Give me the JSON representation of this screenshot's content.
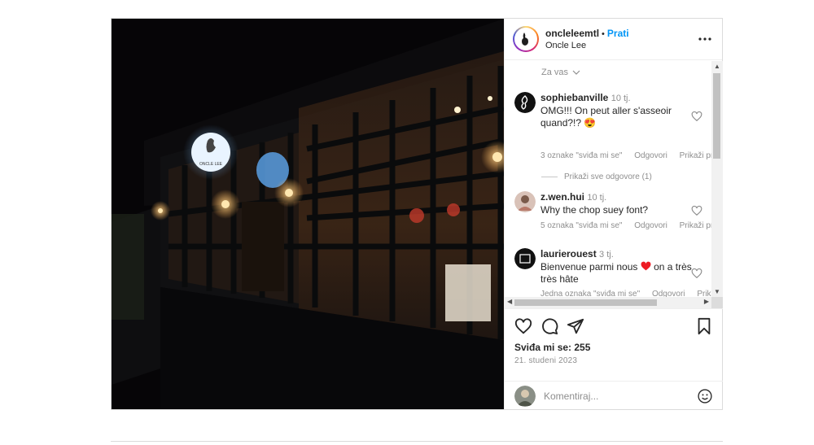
{
  "post": {
    "username": "oncleleemtl",
    "separator": "•",
    "follow_label": "Prati",
    "location": "Oncle Lee",
    "sort_label": "Za vas",
    "likes_text": "Sviđa mi se: 255",
    "date_text": "21. studeni 2023",
    "comment_placeholder": "Komentiraj..."
  },
  "photo": {
    "sign_text": "ONCLE LEE"
  },
  "comments": [
    {
      "user": "sophiebanville",
      "time": "10 tj.",
      "text": "OMG!!! On peut aller s'asseoir quand?!? 😍",
      "likes": "3 oznake \"sviđa mi se\"",
      "reply": "Odgovori",
      "translate": "Prikaži prijevod",
      "view_replies": "Prikaži sve odgovore (1)"
    },
    {
      "user": "z.wen.hui",
      "time": "10 tj.",
      "text": "Why the chop suey font?",
      "likes": "5 oznaka \"sviđa mi se\"",
      "reply": "Odgovori",
      "translate": "Prikaži prijevod"
    },
    {
      "user": "laurierouest",
      "time": "3 tj.",
      "text_before": "Bienvenue parmi nous",
      "text_after": "on a très très hâte",
      "likes": "Jedna oznaka \"sviđa mi se\"",
      "reply": "Odgovori",
      "translate": "Prikaži prijevod"
    }
  ],
  "icons": [
    "more-options-icon",
    "heart-icon",
    "comment-icon",
    "share-icon",
    "bookmark-icon",
    "emoji-icon",
    "chevron-down-icon"
  ],
  "colors": {
    "accent": "#0095f6",
    "heart_red": "#ed1c24",
    "muted": "#8e8e8e"
  }
}
